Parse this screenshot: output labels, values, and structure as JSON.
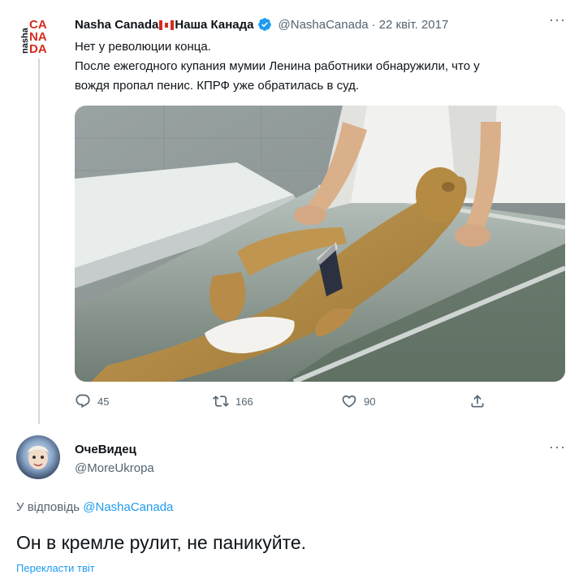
{
  "tweet": {
    "logo_text": "nasha CANADA",
    "author_name_left": "Nasha Canada",
    "author_name_right": "Наша Канада",
    "author_handle": "@NashaCanada",
    "separator": "·",
    "date": "22 квіт. 2017",
    "more": "···",
    "text_lines": [
      "Нет у революции конца.",
      "После ежегодного купания мумии Ленина работники обнаружили, что у",
      "вождя пропал пенис. КПРФ уже обратилась в суд."
    ],
    "stats": {
      "replies": "45",
      "retweets": "166",
      "likes": "90"
    }
  },
  "reply": {
    "name": "ОчеВидец",
    "handle": "@MoreUkropa",
    "more": "···",
    "reply_prefix": "У відповідь",
    "reply_to": "@NashaCanada",
    "text": "Он в кремле рулит, не паникуйте.",
    "translate": "Перекласти твіт"
  },
  "colors": {
    "text": "#0f1419",
    "secondary": "#536471",
    "link": "#1d9bf0",
    "verified": "#1d9bf0",
    "logo_red": "#d52b1e"
  },
  "icons": [
    "reply-icon",
    "retweet-icon",
    "like-icon",
    "share-icon",
    "verified-badge-icon",
    "canada-flag-icon"
  ]
}
